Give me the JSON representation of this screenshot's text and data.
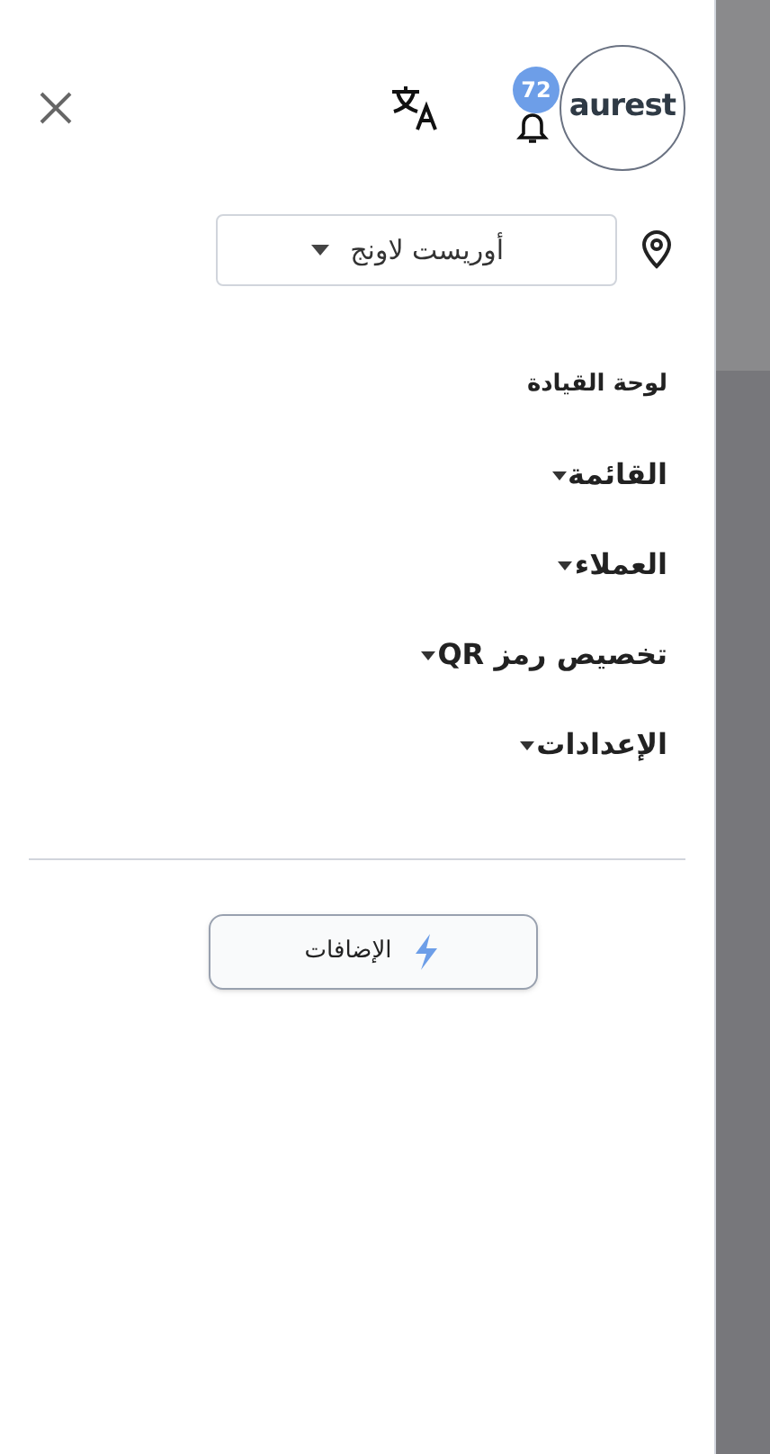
{
  "header": {
    "logo_text": "aurest",
    "notifications": {
      "count": "72"
    }
  },
  "branch_select": {
    "value": "أوريست لاونج"
  },
  "menu": [
    {
      "label": "لوحة القيادة",
      "kind": "link"
    },
    {
      "label": "القائمة",
      "kind": "dropdown"
    },
    {
      "label": "العملاء",
      "kind": "dropdown"
    },
    {
      "label": "تخصيص رمز QR",
      "kind": "dropdown"
    },
    {
      "label": "الإعدادات",
      "kind": "dropdown"
    }
  ],
  "addons_button": {
    "label": "الإضافات"
  }
}
